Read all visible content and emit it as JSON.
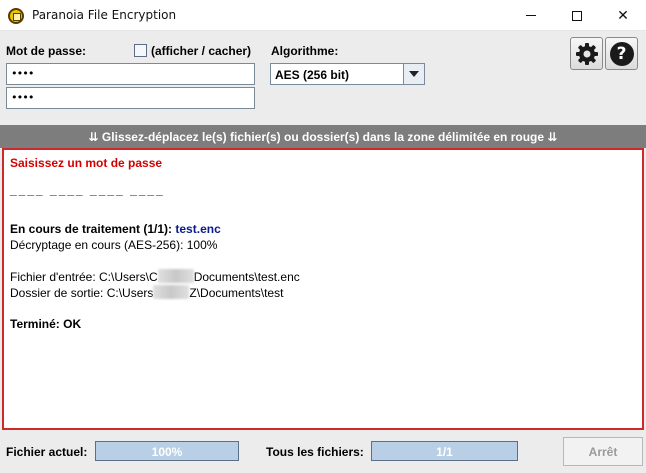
{
  "window": {
    "title": "Paranoia File Encryption",
    "minimize": "—",
    "maximize": "☐",
    "close": "✕"
  },
  "form": {
    "password_label": "Mot de passe:",
    "show_hide_label": "(afficher / cacher)",
    "show_hide_checked": false,
    "password_value": "••••",
    "confirm_value": "••••",
    "algorithm_label": "Algorithme:",
    "algorithm_value": "AES (256 bit)"
  },
  "icons": {
    "settings": "gear-icon",
    "help": "help-icon",
    "help_glyph": "?"
  },
  "banner": {
    "text": "⇊ Glissez-déplacez le(s) fichier(s) ou dossier(s) dans la zone délimitée en rouge ⇊"
  },
  "log": {
    "prompt": "Saisissez un mot de passe",
    "strength": "____ ____ ____ ____",
    "processing_label": "En cours de traitement (1/1):",
    "processing_file": "test.enc",
    "decrypting": "Décryptage en cours (AES-256): 100%",
    "input_prefix": "Fichier d'entrée: C:\\Users\\",
    "input_partial": "C",
    "input_suffix": "Documents\\test.enc",
    "output_prefix": "Dossier de sortie: C:\\Users",
    "output_suffix": "Z\\Documents\\test",
    "done": "Terminé: OK"
  },
  "status": {
    "current_label": "Fichier actuel:",
    "current_progress": 100,
    "current_text": "100%",
    "all_label": "Tous les fichiers:",
    "all_progress": 100,
    "all_text": "1/1",
    "stop_label": "Arrêt"
  },
  "colors": {
    "accent_red": "#cc2a2a",
    "banner_gray": "#7d7d7d",
    "progress_fill": "#b8cfe5"
  }
}
